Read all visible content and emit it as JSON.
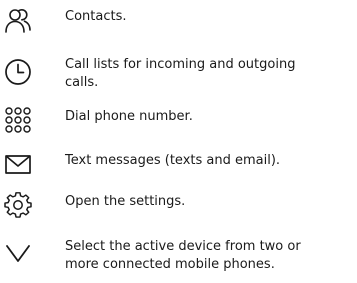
{
  "items": [
    {
      "icon": "contacts-icon",
      "text": "Contacts."
    },
    {
      "icon": "clock-icon",
      "text": "Call lists for incoming and outgoing\ncalls."
    },
    {
      "icon": "dialpad-icon",
      "text": "Dial phone number."
    },
    {
      "icon": "envelope-icon",
      "text": "Text messages (texts and email)."
    },
    {
      "icon": "gear-icon",
      "text": "Open the settings."
    },
    {
      "icon": "chevron-down-icon",
      "text": "Select the active device from two or\nmore connected mobile phones."
    }
  ]
}
